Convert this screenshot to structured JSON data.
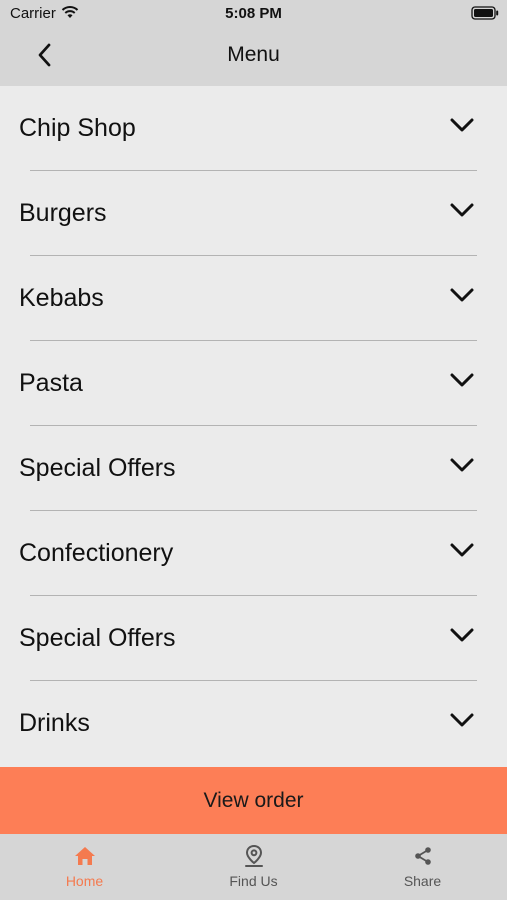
{
  "status_bar": {
    "carrier": "Carrier",
    "time": "5:08 PM"
  },
  "nav": {
    "title": "Menu"
  },
  "menu": {
    "items": [
      {
        "label": "Chip Shop"
      },
      {
        "label": "Burgers"
      },
      {
        "label": "Kebabs"
      },
      {
        "label": "Pasta"
      },
      {
        "label": "Special Offers"
      },
      {
        "label": "Confectionery"
      },
      {
        "label": "Special Offers"
      },
      {
        "label": "Drinks"
      }
    ]
  },
  "view_order": {
    "label": "View order"
  },
  "tabs": [
    {
      "label": "Home",
      "icon": "home-icon",
      "active": true
    },
    {
      "label": "Find Us",
      "icon": "location-pin-icon",
      "active": false
    },
    {
      "label": "Share",
      "icon": "share-icon",
      "active": false
    }
  ],
  "colors": {
    "accent": "#fd7e56",
    "active_tab": "#f47a4f",
    "bar_background": "#d6d6d6",
    "list_background": "#ebebeb"
  }
}
